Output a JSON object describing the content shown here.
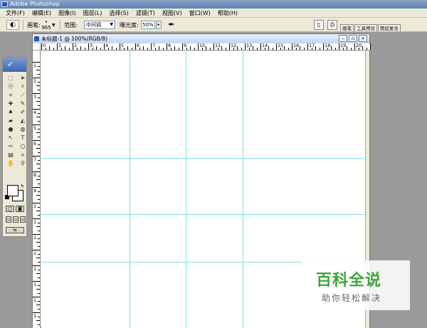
{
  "app": {
    "title": "Adobe Photoshop"
  },
  "menu": [
    "文件(F)",
    "编辑(E)",
    "图像(I)",
    "图层(L)",
    "选择(S)",
    "滤镜(T)",
    "视图(V)",
    "窗口(W)",
    "帮助(H)"
  ],
  "options": {
    "brush_label": "画笔:",
    "brush_size": "965",
    "range_label": "范围:",
    "range_value": "中间调",
    "exposure_label": "曝光度:",
    "exposure_value": "50%"
  },
  "palette_well": [
    "画笔",
    "工具预设",
    "图层复合"
  ],
  "document": {
    "title": "未标题-1 @ 100%(RGB/8)"
  },
  "rulers": {
    "horizontal_labels": [
      "0",
      "1",
      "2",
      "3",
      "4",
      "5",
      "6",
      "7",
      "8",
      "9",
      "10",
      "11",
      "12",
      "13",
      "14",
      "15",
      "16",
      "17",
      "18",
      "19",
      "20",
      "21"
    ],
    "vertical_labels": [
      "1",
      "2",
      "3",
      "4",
      "5",
      "6",
      "7",
      "8",
      "9",
      "1",
      "1",
      "1",
      "1",
      "1",
      "1",
      "1",
      "1",
      "1"
    ]
  },
  "watermark": {
    "main": "百科全说",
    "sub": "助你轻松解决"
  },
  "colors": {
    "guide": "#7fe0e6",
    "watermark_green": "#3ca63c"
  }
}
